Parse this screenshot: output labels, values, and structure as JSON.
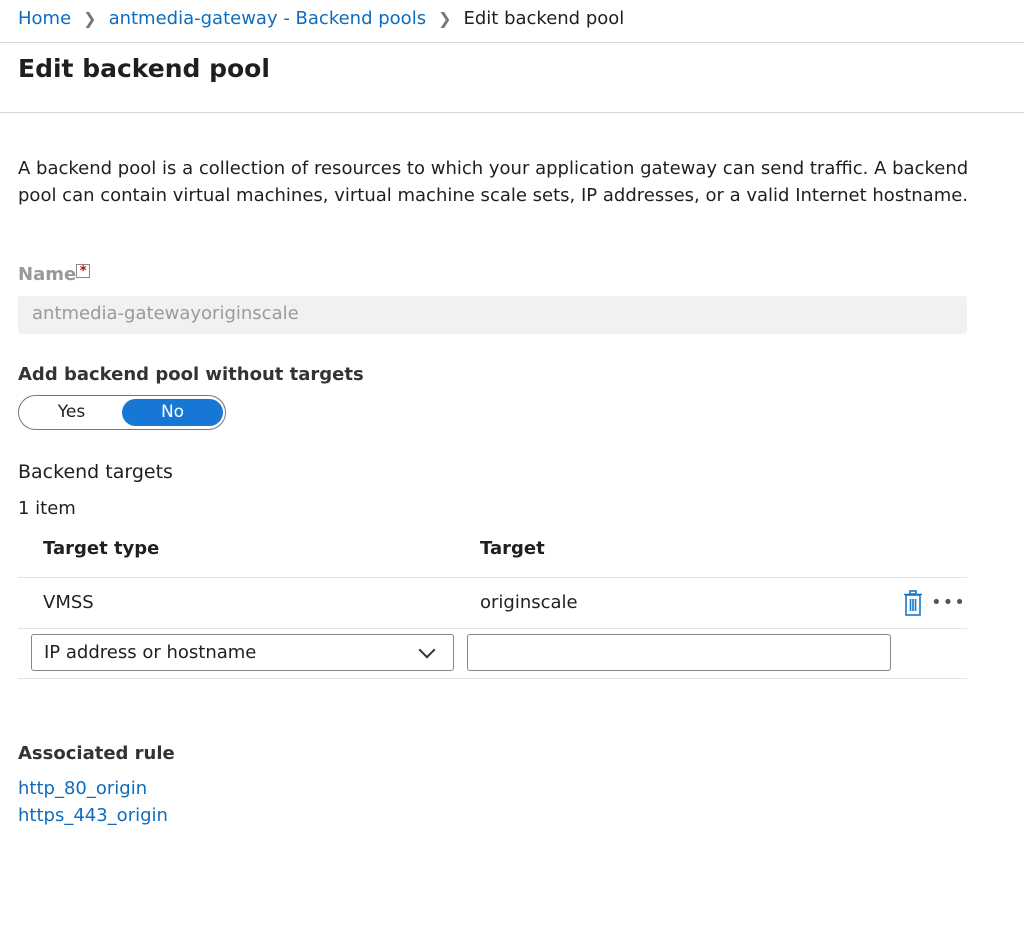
{
  "breadcrumb": {
    "home": "Home",
    "pools": "antmedia-gateway - Backend pools",
    "current": "Edit backend pool"
  },
  "page_title": "Edit backend pool",
  "description": "A backend pool is a collection of resources to which your application gateway can send traffic. A backend pool can contain virtual machines, virtual machine scale sets, IP addresses, or a valid Internet hostname.",
  "name_field": {
    "label": "Name",
    "required": "*",
    "value": "antmedia-gatewayoriginscale"
  },
  "without_targets": {
    "label": "Add backend pool without targets",
    "options": [
      "Yes",
      "No"
    ],
    "selected": "No"
  },
  "targets": {
    "heading": "Backend targets",
    "count": "1 item",
    "columns": [
      "Target type",
      "Target"
    ],
    "rows": [
      {
        "type": "VMSS",
        "target": "originscale"
      }
    ],
    "new_row": {
      "type_select": "IP address or hostname",
      "target_value": ""
    }
  },
  "associated_rule": {
    "heading": "Associated rule",
    "links": [
      "http_80_origin",
      "https_443_origin"
    ]
  },
  "colors": {
    "accent": "#1677d4",
    "link": "#0f6cbd"
  }
}
